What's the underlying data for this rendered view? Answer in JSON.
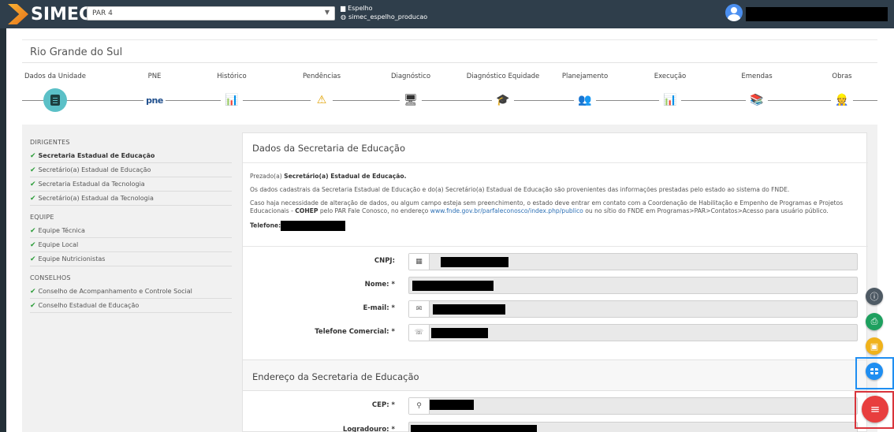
{
  "app": {
    "logo_text": "SIMEC",
    "program_selected": "PAR 4",
    "env_line1": "Espelho",
    "env_line2": "simec_espelho_producao"
  },
  "state_title": "Rio Grande do Sul",
  "steps": [
    {
      "label": "Dados da Unidade",
      "icon": "document-icon",
      "active": true
    },
    {
      "label": "PNE",
      "icon": "pne-icon",
      "glyph": "pne"
    },
    {
      "label": "Histórico",
      "icon": "history-chart-icon",
      "glyph": "📊"
    },
    {
      "label": "Pendências",
      "icon": "warning-icon",
      "glyph": "⚠"
    },
    {
      "label": "Diagnóstico",
      "icon": "diagnostic-screen-icon",
      "glyph": "🖥"
    },
    {
      "label": "Diagnóstico Equidade",
      "icon": "equity-icon",
      "glyph": "🎓"
    },
    {
      "label": "Planejamento",
      "icon": "planning-icon",
      "glyph": "👥"
    },
    {
      "label": "Execução",
      "icon": "execution-chart-icon",
      "glyph": "📊"
    },
    {
      "label": "Emendas",
      "icon": "amendments-icon",
      "glyph": "📚"
    },
    {
      "label": "Obras",
      "icon": "construction-worker-icon",
      "glyph": "👷"
    }
  ],
  "sidebar": {
    "sections": [
      {
        "title": "DIRIGENTES",
        "items": [
          {
            "label": "Secretaria Estadual de Educação",
            "bold": true
          },
          {
            "label": "Secretário(a) Estadual de Educação"
          },
          {
            "label": "Secretaria Estadual da Tecnologia"
          },
          {
            "label": "Secretário(a) Estadual da Tecnologia"
          }
        ]
      },
      {
        "title": "EQUIPE",
        "items": [
          {
            "label": "Equipe Técnica"
          },
          {
            "label": "Equipe Local"
          },
          {
            "label": "Equipe Nutricionistas"
          }
        ]
      },
      {
        "title": "CONSELHOS",
        "items": [
          {
            "label": "Conselho de Acompanhamento e Controle Social"
          },
          {
            "label": "Conselho Estadual de Educação"
          }
        ]
      }
    ]
  },
  "panel": {
    "title": "Dados da Secretaria de Educação",
    "notice": {
      "greeting_prefix": "Prezado(a) ",
      "greeting_bold": "Secretário(a) Estadual de Educação.",
      "p2": "Os dados cadastrais da Secretaria Estadual de Educação e do(a) Secretário(a) Estadual de Educação são provenientes das informações prestadas pelo estado ao sistema do FNDE.",
      "p3_a": "Caso haja necessidade de alteração de dados, ou algum campo esteja sem preenchimento, o estado deve entrar em contato com a Coordenação de Habilitação e Empenho de Programas e Projetos Educacionais - ",
      "p3_bold": "COHEP",
      "p3_b": " pelo PAR Fale Conosco, no endereço ",
      "p3_link": "www.fnde.gov.br/parfaleconosco/index.php/publico",
      "p3_c": " ou no sítio do FNDE em Programas>PAR>Contatos>Acesso para usuário público.",
      "phone_label": "Telefone:"
    },
    "fields": [
      {
        "label": "CNPJ:",
        "icon": "building-icon"
      },
      {
        "label": "Nome: *"
      },
      {
        "label": "E-mail: *",
        "icon": "envelope-icon"
      },
      {
        "label": "Telefone Comercial: *",
        "icon": "phone-icon"
      }
    ],
    "section2_title": "Endereço da Secretaria de Educação",
    "fields2": [
      {
        "label": "CEP: *",
        "icon": "map-pin-icon"
      },
      {
        "label": "Logradouro: *"
      }
    ]
  },
  "fabs": [
    {
      "name": "info-button",
      "icon": "info-icon"
    },
    {
      "name": "print-button",
      "icon": "print-icon"
    },
    {
      "name": "calendar-button",
      "icon": "calendar-icon"
    },
    {
      "name": "grid-button",
      "icon": "grid-icon"
    },
    {
      "name": "menu-button",
      "icon": "menu-icon"
    }
  ]
}
